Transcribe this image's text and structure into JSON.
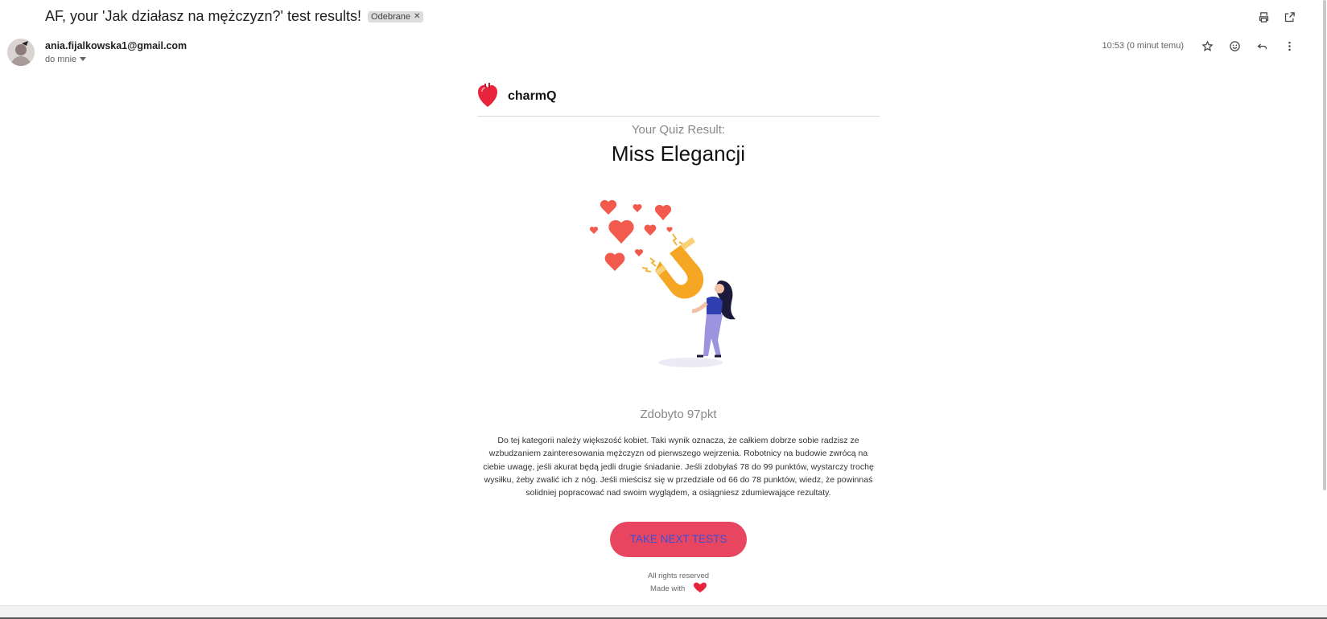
{
  "email": {
    "subject": "AF, your 'Jak działasz na mężczyzn?' test results!",
    "label": "Odebrane",
    "sender": "ania.fijalkowska1@gmail.com",
    "recipient": "do mnie",
    "time": "10:53 (0 minut temu)"
  },
  "message": {
    "brand": "charmQ",
    "quiz_label": "Your Quiz Result:",
    "result_title": "Miss Elegancji",
    "score": "Zdobyto 97pkt",
    "description": "Do tej kategorii należy większość kobiet. Taki wynik oznacza, że całkiem dobrze sobie radzisz ze wzbudzaniem zainteresowania mężczyzn od pierwszego wejrzenia. Robotnicy na budowie zwrócą na ciebie uwagę, jeśli akurat będą jedli drugie śniadanie. Jeśli zdobyłaś 78 do 99 punktów, wystarczy trochę wysiłku, żeby zwalić ich z nóg. Jeśli mieścisz się w przedziale od 66 do 78 punktów, wiedz, że powinnaś solidniej popracować nad swoim wyglądem, a osiągniesz zdumiewające rezultaty.",
    "cta": "TAKE NEXT TESTS",
    "footer_rights": "All rights reserved",
    "footer_made_with": "Made with"
  },
  "icons": [
    "print-icon",
    "open-in-new-icon",
    "star-icon",
    "emoji-icon",
    "reply-icon",
    "more-vert-icon",
    "heart-logo-icon",
    "magnet-illustration",
    "heart-icon"
  ],
  "colors": {
    "cta_bg": "#e84660",
    "cta_text": "#3b4fd8",
    "heart": "#e8243c"
  }
}
